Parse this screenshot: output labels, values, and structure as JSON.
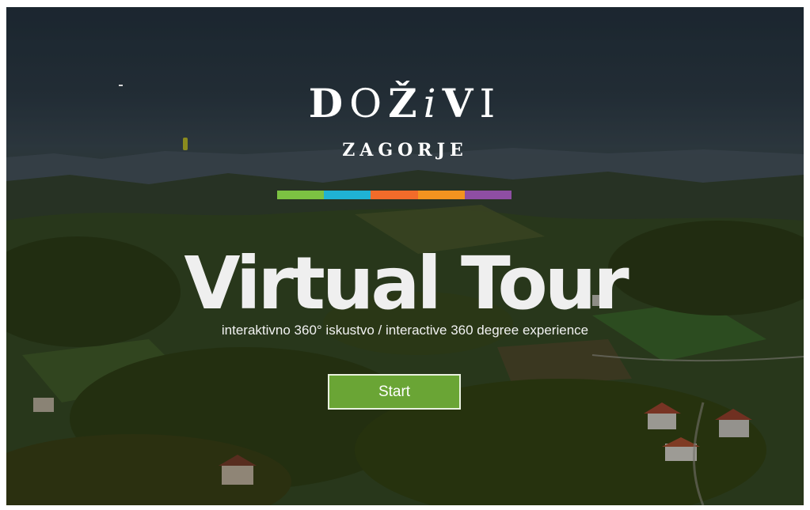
{
  "logo": {
    "wordmark_parts": [
      {
        "text": "D",
        "style": "b"
      },
      {
        "text": "O",
        "style": "l"
      },
      {
        "text": "Ž",
        "style": "b"
      },
      {
        "text": "i",
        "style": "i"
      },
      {
        "text": "V",
        "style": "b"
      },
      {
        "text": "I",
        "style": "l"
      }
    ],
    "subtitle": "ZAGORJE",
    "stripe_colors": [
      "#7cc242",
      "#1fb2d4",
      "#f26b2a",
      "#f3931f",
      "#8e4ea3"
    ]
  },
  "hero": {
    "title": "Virtual Tour",
    "subtitle": "interaktivno 360° iskustvo / interactive 360 degree experience"
  },
  "start_button": {
    "label": "Start",
    "color": "#6aa535"
  }
}
